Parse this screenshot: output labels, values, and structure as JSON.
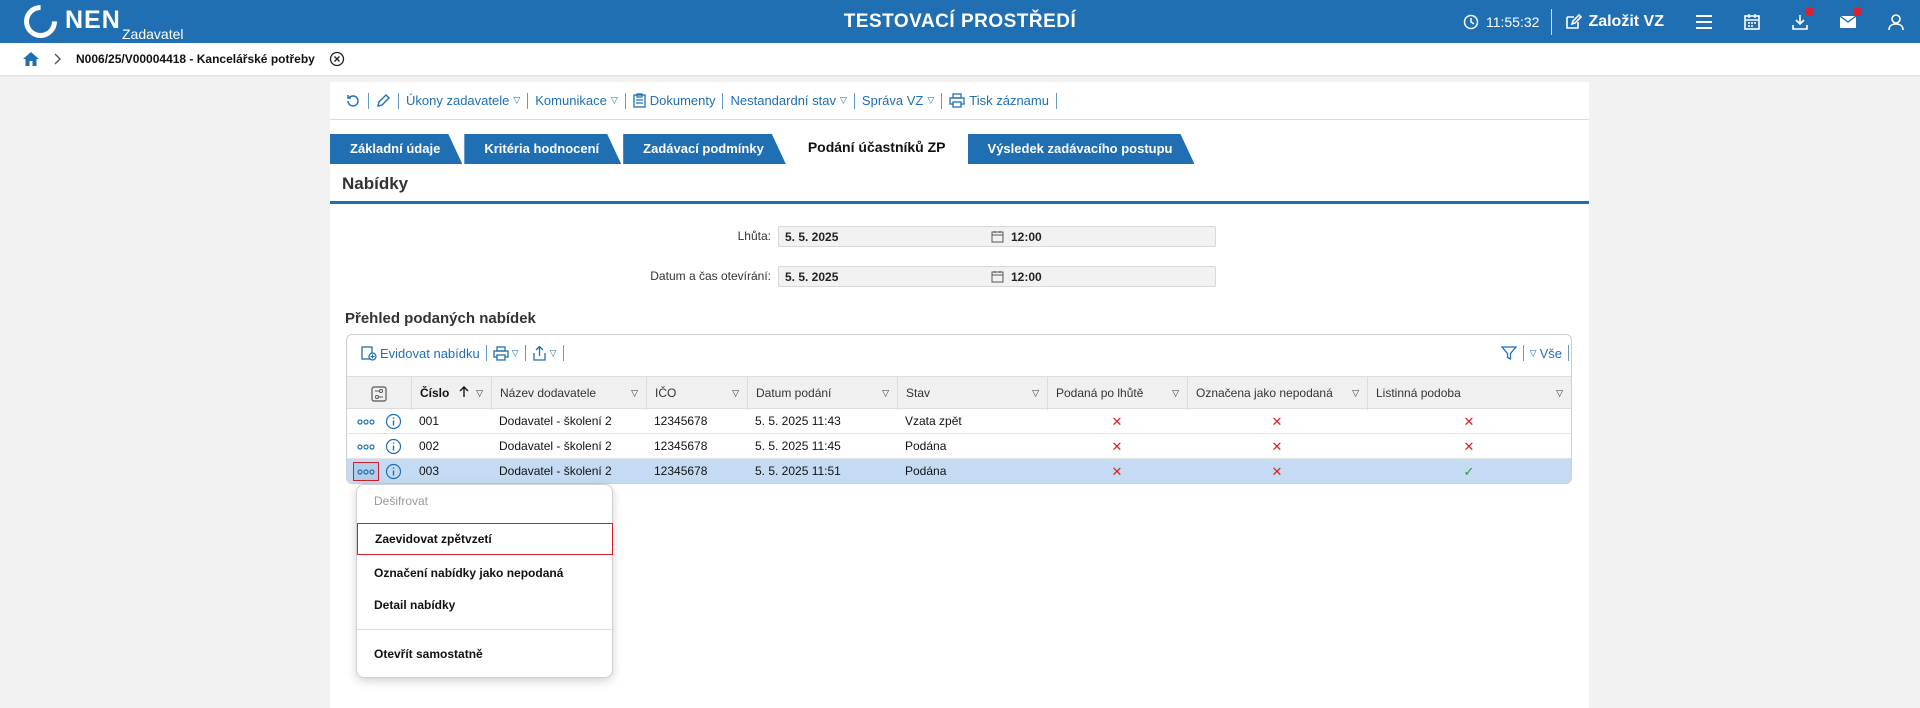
{
  "header": {
    "logo_text": "NEN",
    "logo_sub": "Zadavatel",
    "env_title": "TESTOVACÍ PROSTŘEDÍ",
    "clock": "11:55:32",
    "create_label": "Založit VZ"
  },
  "breadcrumb": {
    "title": "N006/25/V00004418 - Kancelářské potřeby"
  },
  "toolbar": {
    "items": [
      "Úkony zadavatele",
      "Komunikace",
      "Dokumenty",
      "Nestandardní stav",
      "Správa VZ",
      "Tisk záznamu"
    ]
  },
  "tabs": [
    "Základní údaje",
    "Kritéria hodnocení",
    "Zadávací podmínky",
    "Podání účastníků ZP",
    "Výsledek zadávacího postupu"
  ],
  "section": {
    "title": "Nabídky"
  },
  "form": {
    "lhuta_label": "Lhůta:",
    "lhuta_date": "5. 5. 2025",
    "lhuta_time": "12:00",
    "otevirani_label": "Datum a čas otevírání:",
    "otevirani_date": "5. 5. 2025",
    "otevirani_time": "12:00"
  },
  "overview": {
    "title": "Přehled podaných nabídek",
    "add_label": "Evidovat nabídku",
    "all_label": "Vše"
  },
  "table": {
    "columns": [
      "Číslo",
      "Název dodavatele",
      "IČO",
      "Datum podání",
      "Stav",
      "Podaná po lhůtě",
      "Označena jako nepodaná",
      "Listinná podoba"
    ],
    "rows": [
      {
        "cislo": "001",
        "nazev": "Dodavatel - školení 2",
        "ico": "12345678",
        "datum": "5. 5. 2025 11:43",
        "stav": "Vzata zpět",
        "po_lhute": false,
        "nepodana": false,
        "listinna": false
      },
      {
        "cislo": "002",
        "nazev": "Dodavatel - školení 2",
        "ico": "12345678",
        "datum": "5. 5. 2025 11:45",
        "stav": "Podána",
        "po_lhute": false,
        "nepodana": false,
        "listinna": false
      },
      {
        "cislo": "003",
        "nazev": "Dodavatel - školení 2",
        "ico": "12345678",
        "datum": "5. 5. 2025 11:51",
        "stav": "Podána",
        "po_lhute": false,
        "nepodana": false,
        "listinna": true
      }
    ]
  },
  "context_menu": {
    "items": [
      "Dešifrovat",
      "Zaevidovat zpětvzetí",
      "Označení nabídky jako nepodaná",
      "Detail nabídky",
      "Otevřít samostatně"
    ]
  },
  "colors": {
    "brand": "#1f6fb2",
    "selected_row": "#c5dbf3",
    "error": "#e0202a",
    "success": "#2c9a3a"
  }
}
